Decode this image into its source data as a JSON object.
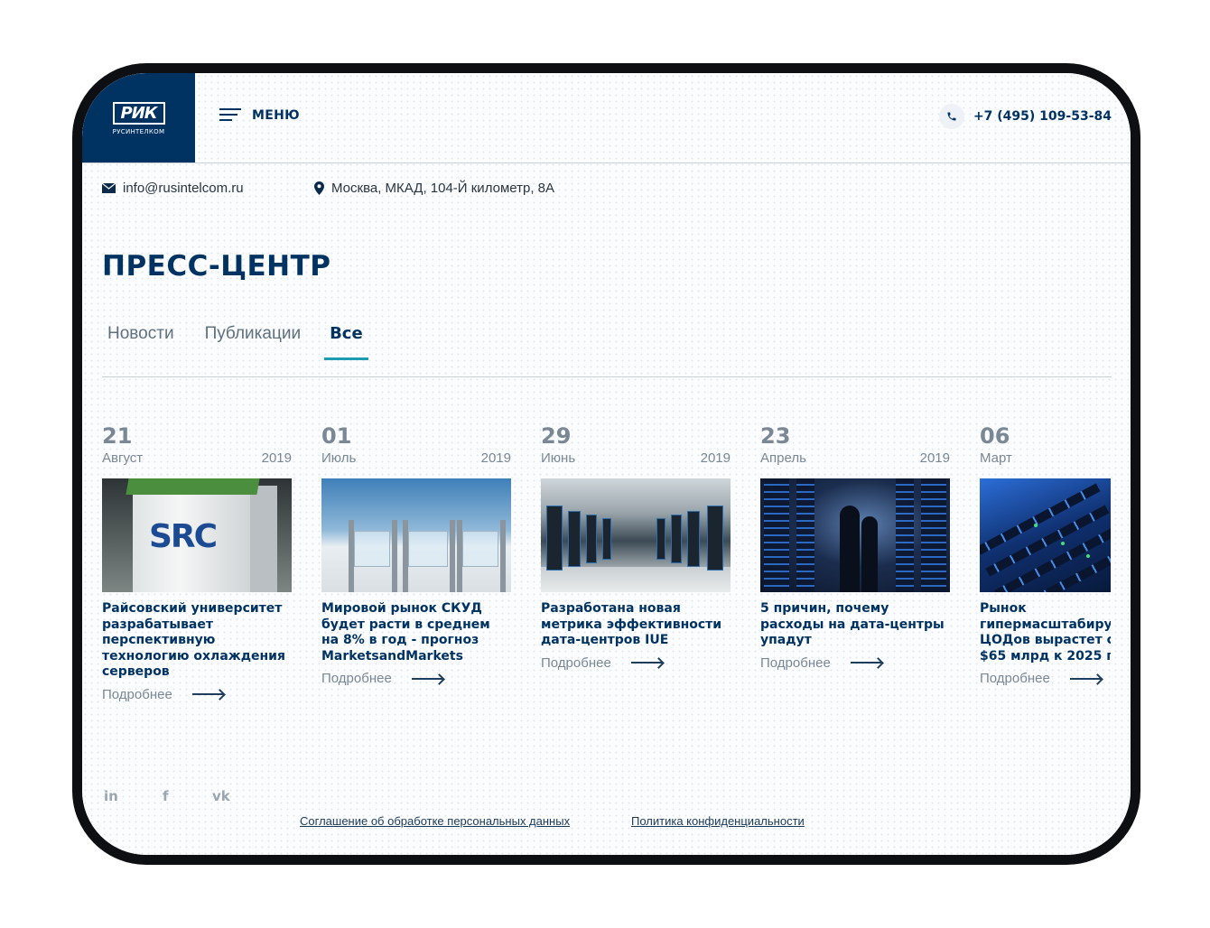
{
  "logo": {
    "mark": "РИК",
    "subtitle": "РУСИНТЕЛКОМ"
  },
  "header": {
    "menu_label": "МЕНЮ",
    "phone": "+7 (495) 109-53-84"
  },
  "contacts": {
    "email": "info@rusintelcom.ru",
    "address": "Москва, МКАД, 104-Й километр, 8А"
  },
  "page_title": "ПРЕСС-ЦЕНТР",
  "tabs": [
    {
      "label": "Новости",
      "active": false
    },
    {
      "label": "Публикации",
      "active": false
    },
    {
      "label": "Все",
      "active": true
    }
  ],
  "news": [
    {
      "day": "21",
      "month": "Август",
      "year": "2019",
      "headline": "Райсовский университет разрабатывает перспективную технологию охлаждения серверов",
      "more": "Подробнее"
    },
    {
      "day": "01",
      "month": "Июль",
      "year": "2019",
      "headline": "Мировой рынок СКУД будет расти в среднем на 8% в год - прогноз MarketsandMarkets",
      "more": "Подробнее"
    },
    {
      "day": "29",
      "month": "Июнь",
      "year": "2019",
      "headline": "Разработана новая метрика эффективности дата-центров IUE",
      "more": "Подробнее"
    },
    {
      "day": "23",
      "month": "Апрель",
      "year": "2019",
      "headline": "5 причин, почему расходы на дата-центры упадут",
      "more": "Подробнее"
    },
    {
      "day": "06",
      "month": "Март",
      "year": "",
      "headline": "Рынок гипермасштабиру ЦОДов вырастет с $65 млрд к 2025 г",
      "more": "Подробнее"
    }
  ],
  "thumb_text": {
    "src_logo": "SRC"
  },
  "social": {
    "linkedin": "in",
    "facebook": "f",
    "vk": "vk"
  },
  "footer": {
    "agreement": "Соглашение об обработке персональных данных",
    "privacy": "Политика конфиденциальности"
  },
  "colors": {
    "brand": "#003262",
    "accent": "#1d9bb4",
    "muted": "#7a8794"
  }
}
